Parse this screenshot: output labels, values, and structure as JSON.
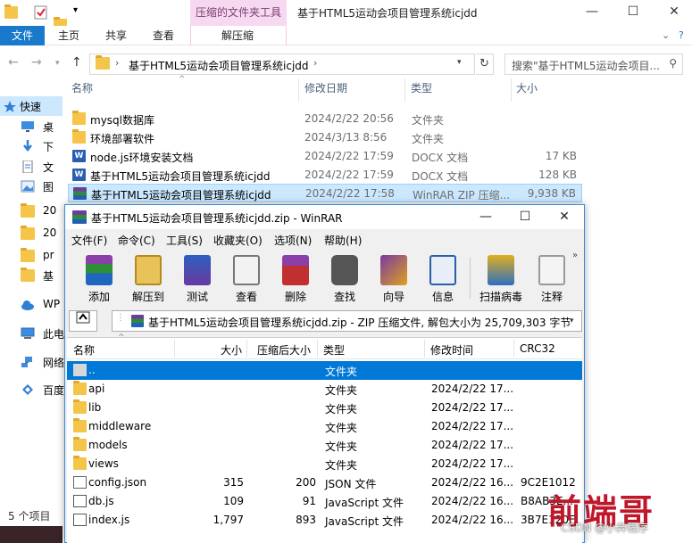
{
  "explorer": {
    "window_title": "基于HTML5运动会项目管理系统icjdd",
    "context_tab": "压缩的文件夹工具",
    "ribbon_tabs": {
      "file": "文件",
      "home": "主页",
      "share": "共享",
      "view": "查看",
      "decompress": "解压缩"
    },
    "address": "基于HTML5运动会项目管理系统icjdd",
    "search_placeholder": "搜索\"基于HTML5运动会项目...",
    "nav_items": [
      {
        "label": "快速",
        "icon": "star-icon"
      },
      {
        "label": "桌",
        "icon": "desktop-icon"
      },
      {
        "label": "下",
        "icon": "download-icon"
      },
      {
        "label": "文",
        "icon": "document-icon"
      },
      {
        "label": "图",
        "icon": "picture-icon"
      },
      {
        "label": "20",
        "icon": "folder-icon"
      },
      {
        "label": "20",
        "icon": "folder-icon"
      },
      {
        "label": "pr",
        "icon": "folder-icon"
      },
      {
        "label": "基",
        "icon": "folder-icon"
      },
      {
        "label": "WP",
        "icon": "cloud-icon"
      },
      {
        "label": "此电",
        "icon": "computer-icon"
      },
      {
        "label": "网络",
        "icon": "network-icon"
      },
      {
        "label": "百度",
        "icon": "baidu-icon"
      }
    ],
    "columns": {
      "name": "名称",
      "date": "修改日期",
      "type": "类型",
      "size": "大小"
    },
    "files": [
      {
        "name": "mysql数据库",
        "date": "2024/2/22 20:56",
        "type": "文件夹",
        "size": "",
        "icon": "folder-icon"
      },
      {
        "name": "环境部署软件",
        "date": "2024/3/13 8:56",
        "type": "文件夹",
        "size": "",
        "icon": "folder-icon"
      },
      {
        "name": "node.js环境安装文档",
        "date": "2024/2/22 17:59",
        "type": "DOCX 文档",
        "size": "17 KB",
        "icon": "word-doc-icon"
      },
      {
        "name": "基于HTML5运动会项目管理系统icjdd",
        "date": "2024/2/22 17:59",
        "type": "DOCX 文档",
        "size": "128 KB",
        "icon": "word-doc-icon"
      },
      {
        "name": "基于HTML5运动会项目管理系统icjdd",
        "date": "2024/2/22 17:58",
        "type": "WinRAR ZIP 压缩...",
        "size": "9,938 KB",
        "icon": "winrar-archive-icon"
      }
    ],
    "status": "5 个项目"
  },
  "winrar": {
    "title": "基于HTML5运动会项目管理系统icjdd.zip - WinRAR",
    "menu": [
      "文件(F)",
      "命令(C)",
      "工具(S)",
      "收藏夹(O)",
      "选项(N)",
      "帮助(H)"
    ],
    "tools": [
      {
        "label": "添加",
        "icon": "add-archive-icon"
      },
      {
        "label": "解压到",
        "icon": "extract-to-icon"
      },
      {
        "label": "测试",
        "icon": "test-icon"
      },
      {
        "label": "查看",
        "icon": "view-icon"
      },
      {
        "label": "删除",
        "icon": "delete-icon"
      },
      {
        "label": "查找",
        "icon": "find-icon"
      },
      {
        "label": "向导",
        "icon": "wizard-icon"
      },
      {
        "label": "信息",
        "icon": "info-icon"
      },
      {
        "label": "扫描病毒",
        "icon": "virus-scan-icon"
      },
      {
        "label": "注释",
        "icon": "comment-icon"
      }
    ],
    "path": "基于HTML5运动会项目管理系统icjdd.zip - ZIP 压缩文件, 解包大小为 25,709,303 字节",
    "columns": {
      "name": "名称",
      "size": "大小",
      "packed": "压缩后大小",
      "type": "类型",
      "modified": "修改时间",
      "crc": "CRC32"
    },
    "rows": [
      {
        "name": "..",
        "size": "",
        "packed": "",
        "type": "文件夹",
        "modified": "",
        "crc": "",
        "icon": "parent-folder-icon"
      },
      {
        "name": "api",
        "size": "",
        "packed": "",
        "type": "文件夹",
        "modified": "2024/2/22 17...",
        "crc": "",
        "icon": "folder-icon"
      },
      {
        "name": "lib",
        "size": "",
        "packed": "",
        "type": "文件夹",
        "modified": "2024/2/22 17...",
        "crc": "",
        "icon": "folder-icon"
      },
      {
        "name": "middleware",
        "size": "",
        "packed": "",
        "type": "文件夹",
        "modified": "2024/2/22 17...",
        "crc": "",
        "icon": "folder-icon"
      },
      {
        "name": "models",
        "size": "",
        "packed": "",
        "type": "文件夹",
        "modified": "2024/2/22 17...",
        "crc": "",
        "icon": "folder-icon"
      },
      {
        "name": "views",
        "size": "",
        "packed": "",
        "type": "文件夹",
        "modified": "2024/2/22 17...",
        "crc": "",
        "icon": "folder-icon"
      },
      {
        "name": "config.json",
        "size": "315",
        "packed": "200",
        "type": "JSON 文件",
        "modified": "2024/2/22 16...",
        "crc": "9C2E1012",
        "icon": "file-icon"
      },
      {
        "name": "db.js",
        "size": "109",
        "packed": "91",
        "type": "JavaScript 文件",
        "modified": "2024/2/22 16...",
        "crc": "B8AB3E...",
        "icon": "js-file-icon"
      },
      {
        "name": "index.js",
        "size": "1,797",
        "packed": "893",
        "type": "JavaScript 文件",
        "modified": "2024/2/22 16...",
        "crc": "3B7E120F",
        "icon": "js-file-icon"
      }
    ]
  },
  "watermark": {
    "logo": "前端哥",
    "text": "CSDN @小奔程序"
  },
  "colors": {
    "accent": "#0078d7",
    "file_tab": "#1979ca",
    "context_tab": "#f6d9f0",
    "selection": "#cce8ff",
    "watermark": "#c0182a"
  }
}
